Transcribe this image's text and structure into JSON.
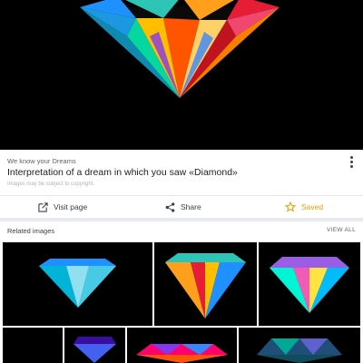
{
  "result": {
    "source": "We know your Dreams",
    "title": "Interpretation of a dream in which you saw «Diamond»",
    "copyright_note": "Images may be subject to copyright."
  },
  "actions": {
    "visit": "Visit page",
    "share": "Share",
    "saved": "Saved"
  },
  "related": {
    "heading": "Related images",
    "view_all": "VIEW ALL"
  },
  "colors": {
    "saved_accent": "#f29900",
    "background": "#000000"
  },
  "icons": [
    "open-in-new-icon",
    "share-icon",
    "star-icon",
    "more-vert-icon"
  ]
}
